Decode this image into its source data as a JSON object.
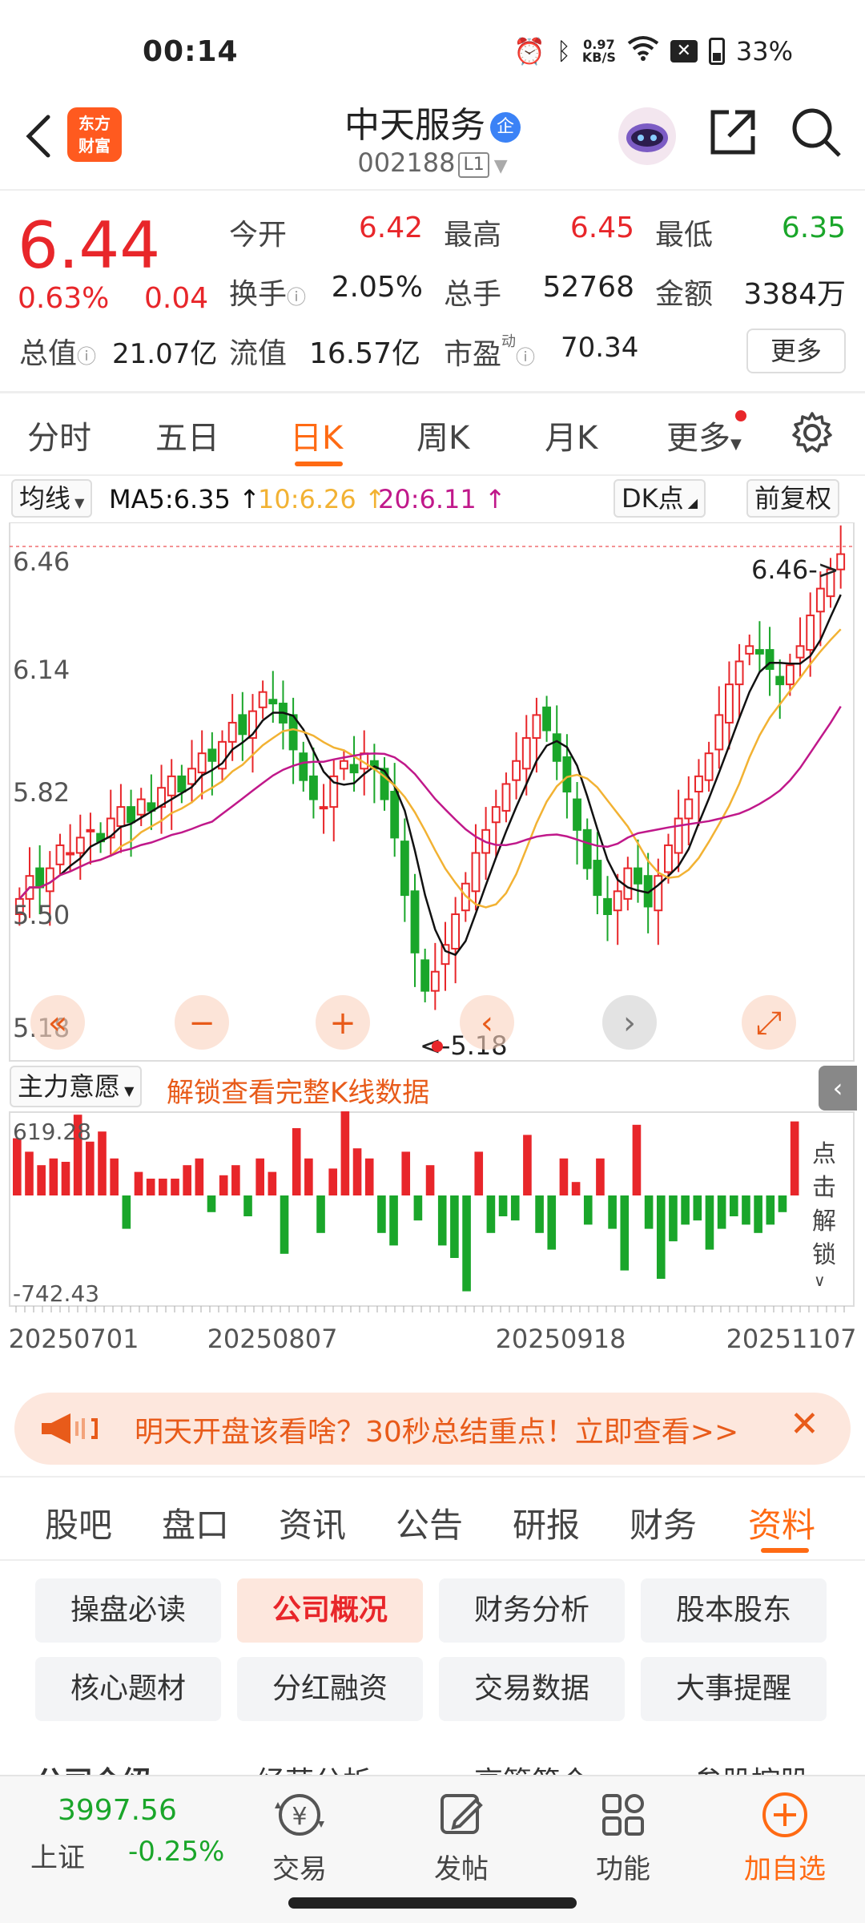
{
  "statusbar": {
    "time": "00:14",
    "net_speed_top": "0.97",
    "net_speed_bottom": "KB/S",
    "battery": "33%"
  },
  "header": {
    "name": "中天服务",
    "badge": "企",
    "code": "002188",
    "level": "L1",
    "logo_line1": "东方",
    "logo_line2": "财富"
  },
  "quote": {
    "price": "6.44",
    "change_pct": "0.63%",
    "change_abs": "0.04",
    "open_label": "今开",
    "open": "6.42",
    "high_label": "最高",
    "high": "6.45",
    "low_label": "最低",
    "low": "6.35",
    "turnover_label": "换手",
    "turnover": "2.05%",
    "volume_label": "总手",
    "volume": "52768",
    "amount_label": "金额",
    "amount": "3384万",
    "mktcap_label": "总值",
    "mktcap": "21.07亿",
    "float_label": "流值",
    "float": "16.57亿",
    "pe_label": "市盈",
    "pe_sup": "动",
    "pe": "70.34",
    "more": "更多"
  },
  "tabs": [
    "分时",
    "五日",
    "日K",
    "周K",
    "月K",
    "更多"
  ],
  "ma": {
    "selector": "均线",
    "ma5": "MA5:6.35",
    "ma10": "10:6.26",
    "ma20": "20:6.11",
    "dk": "DK点",
    "adjust": "前复权"
  },
  "chart_data": {
    "type": "candlestick",
    "y_ticks": [
      "6.46",
      "6.14",
      "5.82",
      "5.50",
      "5.18"
    ],
    "ylim": [
      5.18,
      6.46
    ],
    "max_label": "6.46->",
    "min_label": "<-5.18",
    "x_ticks": [
      "20250701",
      "20250807",
      "20250918",
      "20251107"
    ],
    "indicator_selector": "主力意愿",
    "indicator_notice": "解锁查看完整K线数据",
    "indicator_max": "619.28",
    "indicator_min": "-742.43",
    "unlock_text": "点击解锁",
    "close": [
      5.54,
      5.6,
      5.57,
      5.62,
      5.68,
      5.66,
      5.7,
      5.72,
      5.69,
      5.75,
      5.78,
      5.74,
      5.8,
      5.77,
      5.83,
      5.86,
      5.82,
      5.88,
      5.92,
      5.9,
      5.95,
      6.0,
      5.97,
      6.03,
      6.08,
      6.05,
      6.0,
      5.93,
      5.85,
      5.8,
      5.78,
      5.86,
      5.9,
      5.87,
      5.92,
      5.88,
      5.8,
      5.7,
      5.55,
      5.4,
      5.3,
      5.35,
      5.42,
      5.5,
      5.58,
      5.66,
      5.72,
      5.78,
      5.84,
      5.9,
      5.96,
      6.02,
      5.98,
      5.9,
      5.82,
      5.72,
      5.62,
      5.55,
      5.5,
      5.56,
      5.62,
      5.58,
      5.52,
      5.6,
      5.68,
      5.75,
      5.8,
      5.86,
      5.92,
      6.02,
      6.1,
      6.16,
      6.2,
      6.18,
      6.14,
      6.1,
      6.15,
      6.2,
      6.28,
      6.35,
      6.4,
      6.44
    ]
  },
  "promo": {
    "text": "明天开盘该看啥？30秒总结重点！立即查看>>"
  },
  "tabs2": [
    "股吧",
    "盘口",
    "资讯",
    "公告",
    "研报",
    "财务",
    "资料"
  ],
  "grid": [
    "操盘必读",
    "公司概况",
    "财务分析",
    "股本股东",
    "核心题材",
    "分红融资",
    "交易数据",
    "大事提醒"
  ],
  "subtabs": [
    "公司介绍",
    "经营分析",
    "高管简介",
    "参股控股"
  ],
  "bottombar": {
    "index_value": "3997.56",
    "index_name": "上证",
    "index_change": "-0.25%",
    "trade": "交易",
    "post": "发帖",
    "features": "功能",
    "add": "加自选"
  },
  "colors": {
    "up": "#e8262a",
    "down": "#1aa62a",
    "accent": "#ff6a13",
    "ma5": "#111111",
    "ma10": "#f2b233",
    "ma20": "#c0188a"
  }
}
